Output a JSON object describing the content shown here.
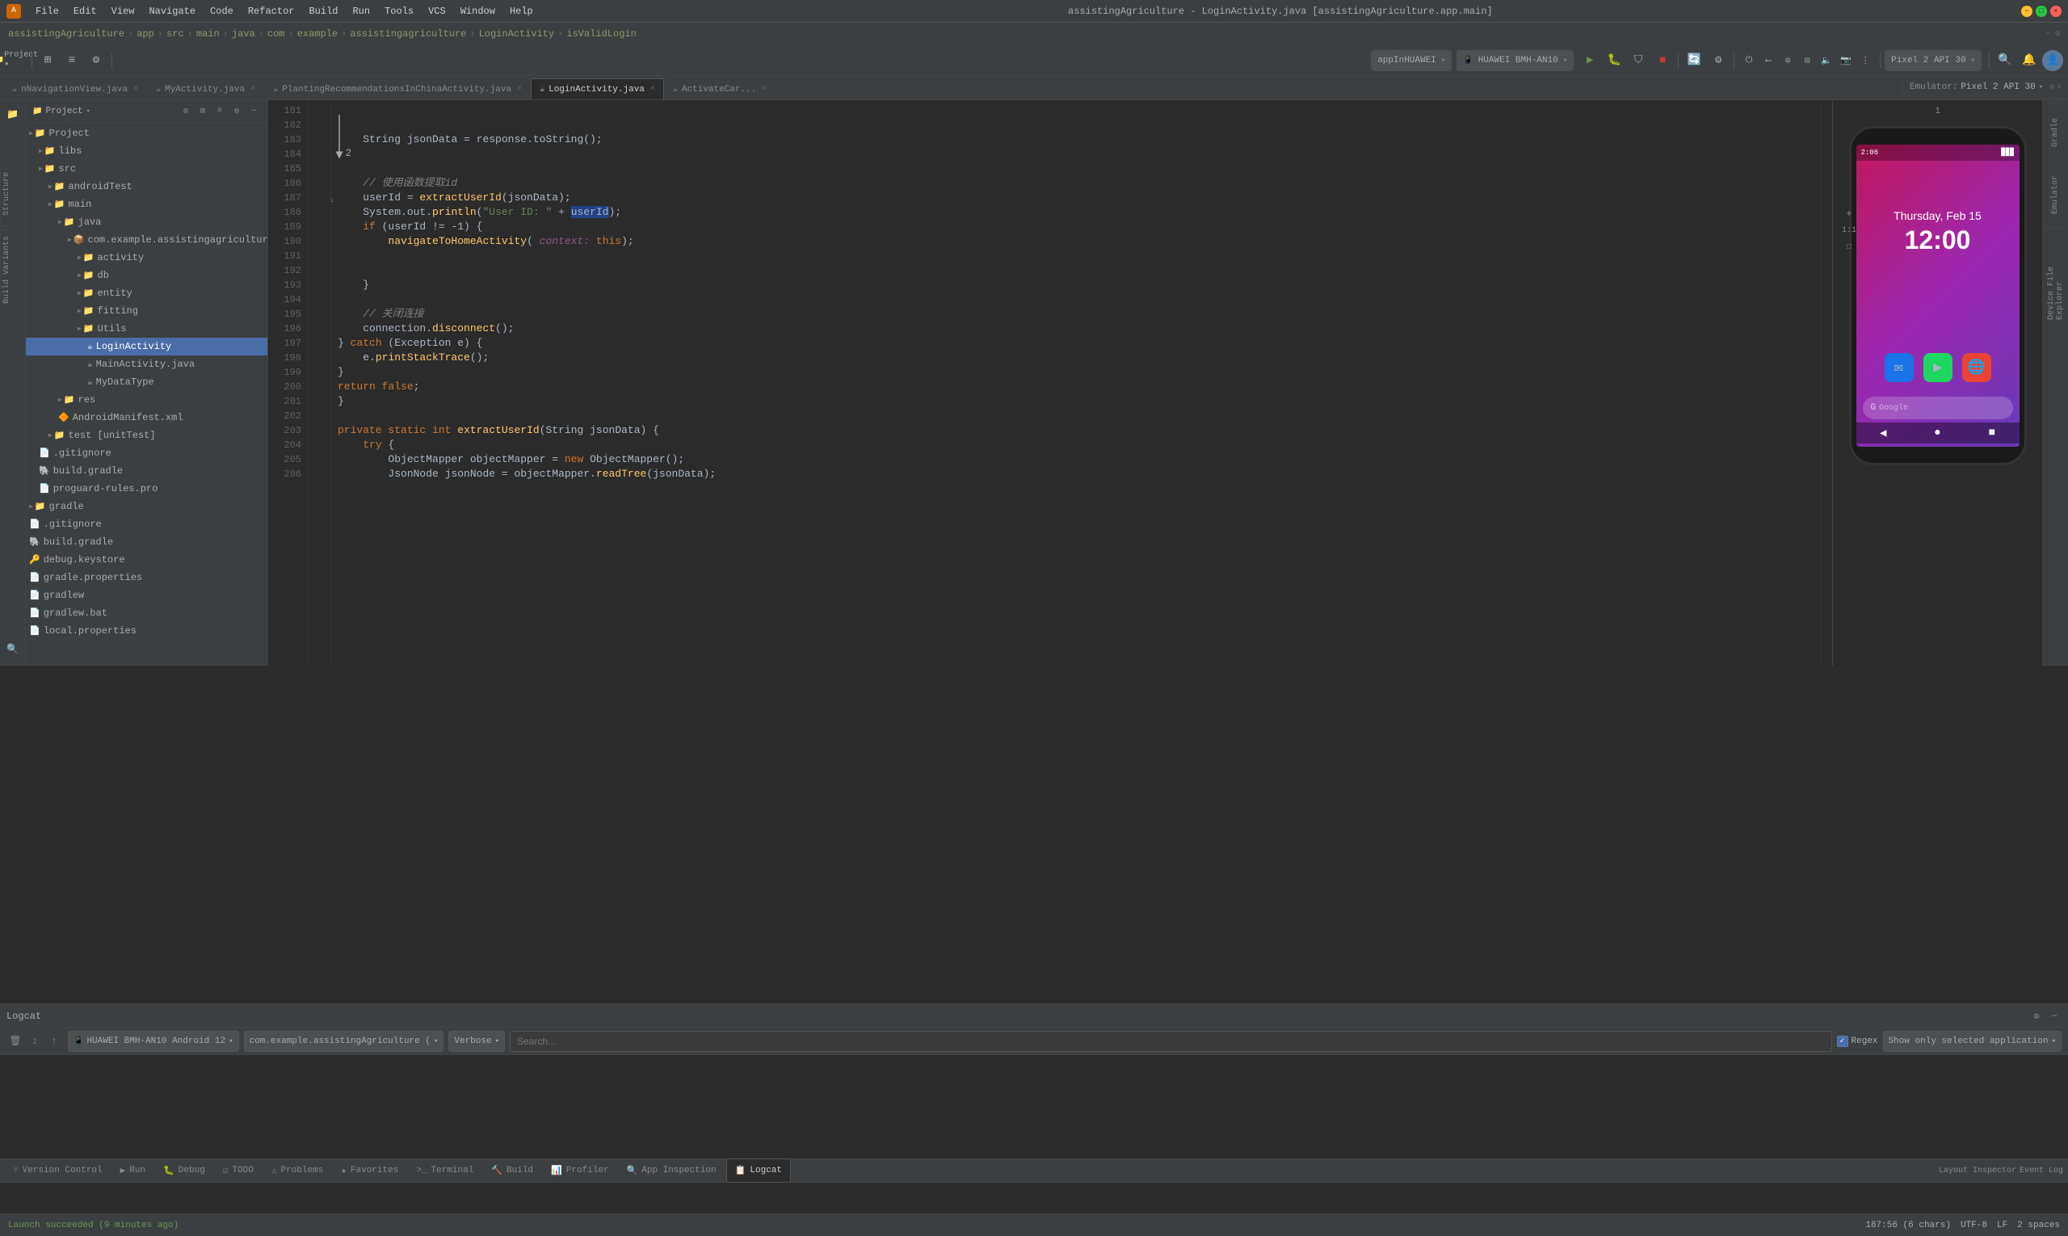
{
  "app": {
    "title": "assistingAgriculture - LoginActivity.java [assistingAgriculture.app.main]",
    "window_controls": {
      "minimize": "−",
      "maximize": "□",
      "close": "×"
    }
  },
  "menu": {
    "items": [
      "File",
      "Edit",
      "View",
      "Navigate",
      "Code",
      "Refactor",
      "Build",
      "Run",
      "Tools",
      "VCS",
      "Window",
      "Help"
    ]
  },
  "breadcrumb": {
    "parts": [
      "assistingAgriculture",
      "app",
      "src",
      "main",
      "java",
      "com",
      "example",
      "assistingagriculture",
      "LoginActivity",
      "isValidLogin"
    ]
  },
  "toolbar": {
    "run_label": "appInHUAWEI",
    "device_label": "HUAWEI BMH-AN10",
    "api_label": "Pixel 2 API 30",
    "step1": "1"
  },
  "tabs": [
    {
      "label": "nNavigationView.java",
      "active": false,
      "icon": "☕"
    },
    {
      "label": "MyActivity.java",
      "active": false,
      "icon": "☕"
    },
    {
      "label": "PlantingRecommendationsInChinaActivity.java",
      "active": false,
      "icon": "☕"
    },
    {
      "label": "LoginActivity.java",
      "active": true,
      "icon": "☕"
    },
    {
      "label": "ActivateCar...",
      "active": false,
      "icon": "☕"
    }
  ],
  "project_panel": {
    "header": "Project",
    "tree": [
      {
        "label": "Project",
        "level": 0,
        "expanded": true,
        "type": "root",
        "icon": "📁"
      },
      {
        "label": "libs",
        "level": 1,
        "type": "folder",
        "icon": "📁"
      },
      {
        "label": "src",
        "level": 1,
        "type": "folder",
        "icon": "📁"
      },
      {
        "label": "androidTest",
        "level": 2,
        "type": "folder",
        "icon": "📁"
      },
      {
        "label": "main",
        "level": 2,
        "type": "folder",
        "icon": "📁"
      },
      {
        "label": "java",
        "level": 3,
        "type": "folder",
        "icon": "📁"
      },
      {
        "label": "com.example.assistingagriculture",
        "level": 4,
        "type": "package",
        "icon": "📦"
      },
      {
        "label": "activity",
        "level": 5,
        "type": "folder",
        "icon": "📁"
      },
      {
        "label": "db",
        "level": 5,
        "type": "folder",
        "icon": "📁"
      },
      {
        "label": "entity",
        "level": 5,
        "type": "folder",
        "icon": "📁"
      },
      {
        "label": "fitting",
        "level": 5,
        "type": "folder",
        "icon": "📁"
      },
      {
        "label": "Utils",
        "level": 5,
        "type": "folder",
        "icon": "📁"
      },
      {
        "label": "LoginActivity",
        "level": 6,
        "type": "java",
        "icon": "☕",
        "selected": true
      },
      {
        "label": "MainActivity.java",
        "level": 6,
        "type": "java",
        "icon": "☕"
      },
      {
        "label": "MyDataType",
        "level": 6,
        "type": "java",
        "icon": "☕"
      },
      {
        "label": "res",
        "level": 3,
        "type": "folder",
        "icon": "📁"
      },
      {
        "label": "AndroidManifest.xml",
        "level": 3,
        "type": "xml",
        "icon": "🔶"
      },
      {
        "label": "test [unitTest]",
        "level": 2,
        "type": "folder",
        "icon": "📁"
      },
      {
        "label": ".gitignore",
        "level": 1,
        "type": "file",
        "icon": "📄"
      },
      {
        "label": "build.gradle",
        "level": 1,
        "type": "gradle",
        "icon": "🐘"
      },
      {
        "label": "proguard-rules.pro",
        "level": 1,
        "type": "file",
        "icon": "📄"
      },
      {
        "label": "gradle",
        "level": 0,
        "type": "folder",
        "icon": "📁"
      },
      {
        "label": ".gitignore",
        "level": 0,
        "type": "file",
        "icon": "📄"
      },
      {
        "label": "build.gradle",
        "level": 0,
        "type": "gradle",
        "icon": "🐘"
      },
      {
        "label": "debug.keystore",
        "level": 0,
        "type": "file",
        "icon": "🔑"
      },
      {
        "label": "gradle.properties",
        "level": 0,
        "type": "file",
        "icon": "📄"
      },
      {
        "label": "gradlew",
        "level": 0,
        "type": "file",
        "icon": "📄"
      },
      {
        "label": "gradlew.bat",
        "level": 0,
        "type": "file",
        "icon": "📄"
      },
      {
        "label": "local.properties",
        "level": 0,
        "type": "file",
        "icon": "📄"
      }
    ]
  },
  "code": {
    "lines": [
      {
        "num": 181,
        "content": ""
      },
      {
        "num": 182,
        "content": ""
      },
      {
        "num": 183,
        "content": "    String jsonData = response.toString();"
      },
      {
        "num": 184,
        "content": ""
      },
      {
        "num": 185,
        "content": ""
      },
      {
        "num": 186,
        "content": "    // 使用函数提取id"
      },
      {
        "num": 187,
        "content": "    userId = extractUserId(jsonData);",
        "breakpoint": true,
        "warning": true
      },
      {
        "num": 188,
        "content": "    System.out.println(\"User ID: \" + userId);"
      },
      {
        "num": 189,
        "content": "    if (userId != -1) {"
      },
      {
        "num": 190,
        "content": "        navigateToHomeActivity( context: this);"
      },
      {
        "num": 191,
        "content": ""
      },
      {
        "num": 192,
        "content": ""
      },
      {
        "num": 193,
        "content": "    }"
      },
      {
        "num": 194,
        "content": ""
      },
      {
        "num": 195,
        "content": "    // 关闭连接"
      },
      {
        "num": 196,
        "content": "    connection.disconnect();"
      },
      {
        "num": 197,
        "content": "} catch (Exception e) {"
      },
      {
        "num": 198,
        "content": "    e.printStackTrace();"
      },
      {
        "num": 199,
        "content": "}"
      },
      {
        "num": 200,
        "content": "return false;"
      },
      {
        "num": 201,
        "content": "}"
      },
      {
        "num": 202,
        "content": ""
      },
      {
        "num": 203,
        "content": "private static int extractUserId(String jsonData) {"
      },
      {
        "num": 204,
        "content": "    try {"
      },
      {
        "num": 205,
        "content": "        ObjectMapper objectMapper = new ObjectMapper();"
      },
      {
        "num": 206,
        "content": "        JsonNode jsonNode = objectMapper.readTree(jsonData);"
      }
    ],
    "annotation_arrow_label": "2"
  },
  "emulator": {
    "label": "Emulator:",
    "api_label": "Pixel 2 API 30",
    "step": "1",
    "ratio": "1:1",
    "phone": {
      "status_time": "2:06",
      "status_signal": "▉▉▉",
      "date_text": "Thursday, Feb 15",
      "search_placeholder": "Google",
      "nav_back": "◀",
      "nav_home": "●",
      "nav_recent": "■"
    }
  },
  "logcat": {
    "header": "Logcat",
    "device_label": "HUAWEI BMH-AN10 Android 12",
    "package_label": "com.example.assistingAgriculture (",
    "verbose_label": "Verbose",
    "search_placeholder": "Search...",
    "regex_label": "Regex",
    "show_selected_label": "Show only selected application"
  },
  "bottom_tools": [
    {
      "label": "Version Control",
      "icon": "⑂",
      "active": false
    },
    {
      "label": "Run",
      "icon": "▶",
      "active": false
    },
    {
      "label": "Debug",
      "icon": "🐛",
      "active": false
    },
    {
      "label": "TODO",
      "icon": "☑",
      "active": false
    },
    {
      "label": "Problems",
      "icon": "⚠",
      "active": false
    },
    {
      "label": "Favorites",
      "icon": "★",
      "active": false
    },
    {
      "label": "Terminal",
      "icon": ">_",
      "active": false
    },
    {
      "label": "Build",
      "icon": "🔨",
      "active": false
    },
    {
      "label": "Profiler",
      "icon": "📊",
      "active": false
    },
    {
      "label": "App Inspection",
      "icon": "🔍",
      "active": false
    },
    {
      "label": "Logcat",
      "icon": "📋",
      "active": true
    }
  ],
  "status_bar": {
    "launch_text": "Launch succeeded (9 minutes ago)",
    "position": "187:56 (6 chars)",
    "encoding": "UTF-8",
    "line_sep": "LF",
    "indent": "2 spaces"
  },
  "right_tabs": [
    "Gradle",
    "Emulator",
    "Device File Explorer"
  ],
  "left_tabs": [
    "Structure",
    "Build Variants"
  ]
}
